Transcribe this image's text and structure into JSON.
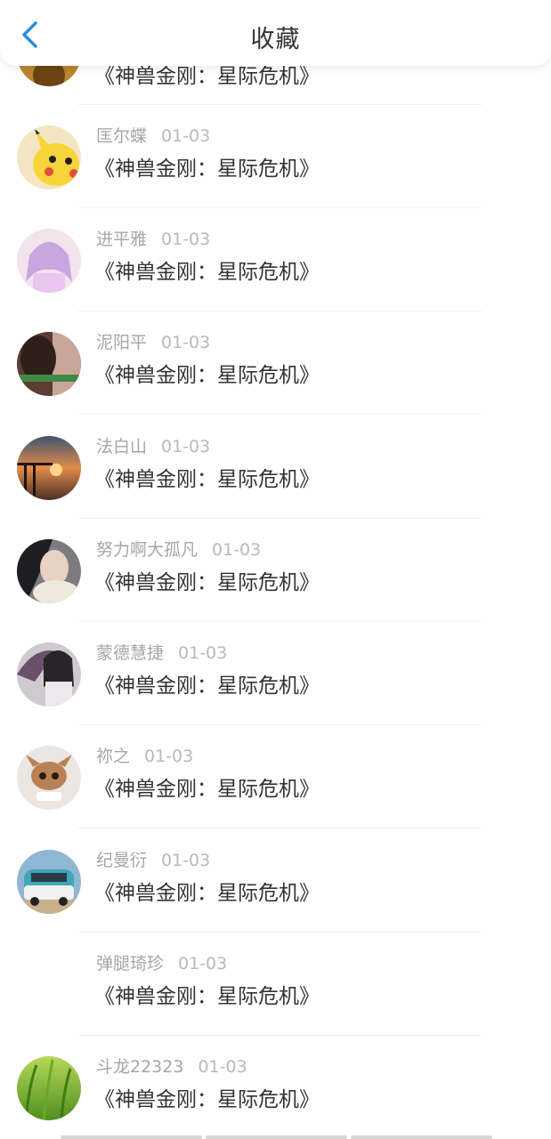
{
  "header": {
    "title": "收藏",
    "back_icon": "chevron-left-icon",
    "accent": "#2a8ee3"
  },
  "items": [
    {
      "user": "",
      "date": "",
      "title": "《神兽金刚：星际危机》",
      "avatar": "partial-avatar"
    },
    {
      "user": "匡尔蝶",
      "date": "01-03",
      "title": "《神兽金刚：星际危机》",
      "avatar": "pikachu-avatar"
    },
    {
      "user": "进平雅",
      "date": "01-03",
      "title": "《神兽金刚：星际危机》",
      "avatar": "anime-girl-avatar"
    },
    {
      "user": "泥阳平",
      "date": "01-03",
      "title": "《神兽金刚：星际危机》",
      "avatar": "photo-avatar"
    },
    {
      "user": "法白山",
      "date": "01-03",
      "title": "《神兽金刚：星际危机》",
      "avatar": "pier-sunset-avatar"
    },
    {
      "user": "努力啊大孤凡",
      "date": "01-03",
      "title": "《神兽金刚：星际危机》",
      "avatar": "girl-scarf-avatar"
    },
    {
      "user": "蒙德慧捷",
      "date": "01-03",
      "title": "《神兽金刚：星际危机》",
      "avatar": "anime-umbrella-avatar"
    },
    {
      "user": "祢之",
      "date": "01-03",
      "title": "《神兽金刚：星际危机》",
      "avatar": "cartoon-cat-avatar"
    },
    {
      "user": "纪曼衍",
      "date": "01-03",
      "title": "《神兽金刚：星际危机》",
      "avatar": "vw-van-avatar"
    },
    {
      "user": "弹腿琦珍",
      "date": "01-03",
      "title": "《神兽金刚：星际危机》",
      "avatar": ""
    },
    {
      "user": "斗龙22323",
      "date": "01-03",
      "title": "《神兽金刚：星际危机》",
      "avatar": "green-grass-avatar"
    }
  ]
}
